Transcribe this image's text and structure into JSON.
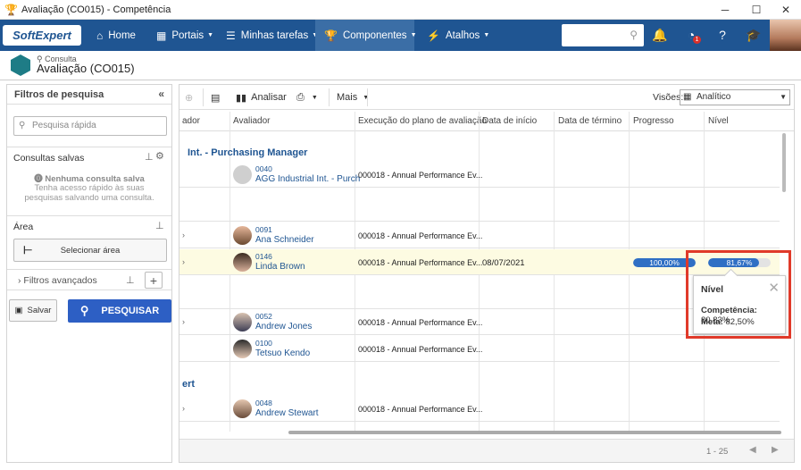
{
  "window": {
    "title": "Avaliação (CO015) - Competência",
    "controls": [
      "─",
      "☐",
      "✕"
    ]
  },
  "nav": {
    "logo": "SoftExpert",
    "items": [
      {
        "label": "Home",
        "icon": "home-icon"
      },
      {
        "label": "Portais",
        "icon": "portal-icon"
      },
      {
        "label": "Minhas tarefas",
        "icon": "tasks-icon"
      },
      {
        "label": "Componentes",
        "icon": "trophy-icon"
      },
      {
        "label": "Atalhos",
        "icon": "bolt-icon"
      }
    ],
    "notification_badge": "1"
  },
  "header": {
    "subtitle": "Consulta",
    "title": "Avaliação (CO015)"
  },
  "filters": {
    "title": "Filtros de pesquisa",
    "quick_search_placeholder": "Pesquisa rápida",
    "saved_queries_label": "Consultas salvas",
    "no_saved_title": "Nenhuma consulta salva",
    "no_saved_text": "Tenha acesso rápido às suas pesquisas salvando uma consulta.",
    "area_label": "Área",
    "select_area_label": "Selecionar área",
    "advanced_filters_label": "Filtros avançados",
    "save_label": "Salvar",
    "search_label": "PESQUISAR"
  },
  "toolbar": {
    "analyze_label": "Analisar",
    "more_label": "Mais",
    "views_label": "Visões:",
    "views_value": "Analítico"
  },
  "table": {
    "headers": [
      "ador",
      "Avaliador",
      "Execução do plano de avaliação",
      "Data de início",
      "Data de término",
      "Progresso",
      "Nível"
    ],
    "groups": [
      "Int. - Purchasing Manager",
      "ert"
    ],
    "rows": [
      {
        "code": "0040",
        "name": "AGG Industrial Int. - Purch",
        "plan": "000018 - Annual Performance Ev..."
      },
      {
        "code": "0091",
        "name": "Ana Schneider",
        "plan": "000018 - Annual Performance Ev..."
      },
      {
        "code": "0146",
        "name": "Linda Brown",
        "plan": "000018 - Annual Performance Ev...",
        "start": "08/07/2021",
        "progress": "100,00%",
        "progress_value": 100,
        "level": "81,67%",
        "level_value": 81.67
      },
      {
        "code": "0052",
        "name": "Andrew Jones",
        "plan": "000018 - Annual Performance Ev..."
      },
      {
        "code": "0100",
        "name": "Tetsuo Kendo",
        "plan": "000018 - Annual Performance Ev..."
      },
      {
        "code": "0048",
        "name": "Andrew Stewart",
        "plan": "000018 - Annual Performance Ev..."
      }
    ],
    "pager": "1 - 25"
  },
  "tooltip": {
    "title": "Nível",
    "competence_label": "Competência:",
    "competence_value": "80,83%",
    "goal_label": "Meta:",
    "goal_value": "82,50%"
  },
  "colors": {
    "nav_bg": "#1f5592",
    "accent": "#2f6fc4",
    "highlight_box": "#e03a2a",
    "row_highlight": "#fdfbe2"
  }
}
